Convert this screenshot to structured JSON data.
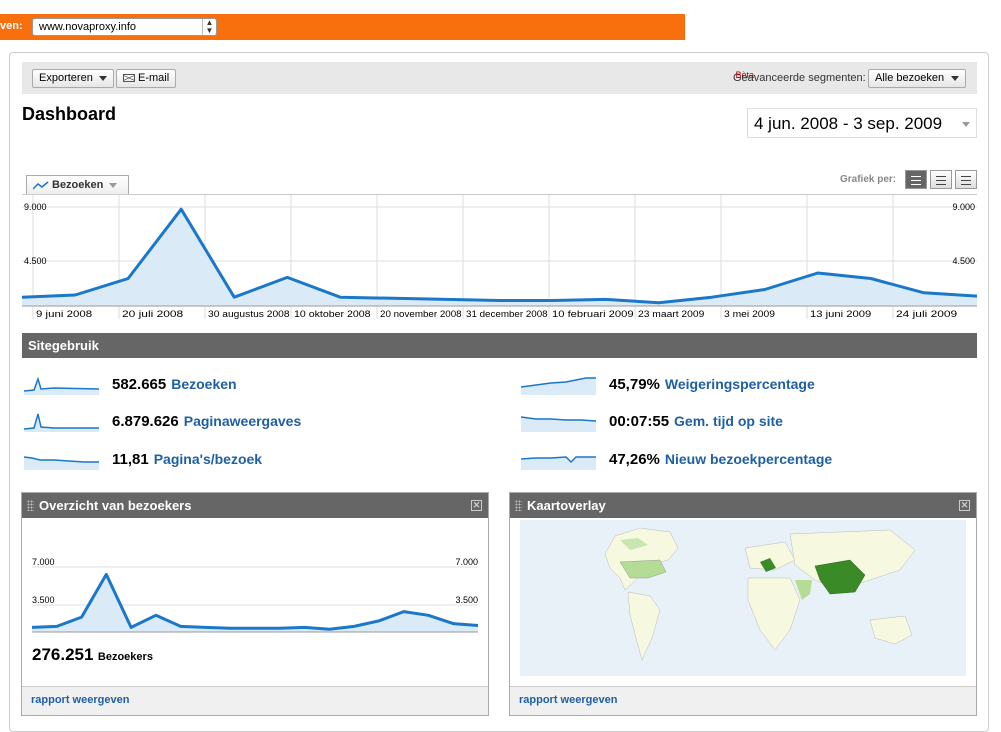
{
  "topbar": {
    "label": "ven:",
    "site": "www.novaproxy.info"
  },
  "toolbar": {
    "export_label": "Exporteren",
    "email_label": "E-mail",
    "beta_label": "Bèta",
    "segments_label": "Geavanceerde segmenten:",
    "segments_value": "Alle bezoeken"
  },
  "page": {
    "title": "Dashboard",
    "date_range": "4 jun. 2008 - 3 sep. 2009"
  },
  "graph": {
    "metric_tab": "Bezoeken",
    "graph_per_label": "Grafiek per:",
    "y_top": "9.000",
    "y_mid": "4.500",
    "x_labels": [
      "9 juni 2008",
      "20 juli 2008",
      "30 augustus 2008",
      "10 oktober 2008",
      "20 november 2008",
      "31 december 2008",
      "10 februari 2009",
      "23 maart 2009",
      "3 mei 2009",
      "13 juni 2009",
      "24 juli 2009"
    ]
  },
  "chart_data": {
    "type": "line",
    "ylim": [
      0,
      9000
    ],
    "yticks": [
      "4.500",
      "9.000"
    ],
    "x": [
      "9 juni 2008",
      "20 juli 2008",
      "30 augustus 2008",
      "10 oktober 2008",
      "20 november 2008",
      "31 december 2008",
      "10 februari 2009",
      "23 maart 2009",
      "3 mei 2009",
      "13 juni 2009",
      "24 juli 2009"
    ],
    "values": [
      800,
      1000,
      2500,
      8800,
      800,
      2600,
      800,
      700,
      600,
      500,
      500,
      600,
      300,
      800,
      1500,
      3000,
      2500,
      1200,
      900
    ],
    "grid": true
  },
  "site_usage": {
    "title": "Sitegebruik",
    "metrics": [
      {
        "value": "582.665",
        "label": "Bezoeken"
      },
      {
        "value": "6.879.626",
        "label": "Paginaweergaves"
      },
      {
        "value": "11,81",
        "label": "Pagina's/bezoek"
      },
      {
        "value": "45,79%",
        "label": "Weigeringspercentage"
      },
      {
        "value": "00:07:55",
        "label": "Gem. tijd op site"
      },
      {
        "value": "47,26%",
        "label": "Nieuw bezoekpercentage"
      }
    ]
  },
  "visitors_panel": {
    "title": "Overzicht van bezoekers",
    "y_top": "7.000",
    "y_mid": "3.500",
    "total": "276.251",
    "total_label": "Bezoekers",
    "footer": "rapport weergeven"
  },
  "map_panel": {
    "title": "Kaartoverlay",
    "footer": "rapport weergeven"
  },
  "colors": {
    "accent_orange": "#f8700d",
    "line_blue": "#1a77c9",
    "link_blue": "#1f5fa4",
    "bar_gray": "#666666"
  }
}
